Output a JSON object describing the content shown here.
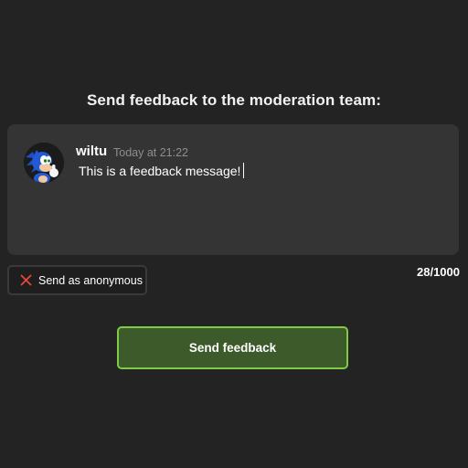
{
  "title": "Send feedback to the moderation team:",
  "message": {
    "username": "wiltu",
    "timestamp": "Today at 21:22",
    "text": "This is a feedback message!",
    "avatar_icon": "hedgehog-avatar-icon"
  },
  "anonymous": {
    "label": "Send as anonymous",
    "icon": "x-icon",
    "checked": false
  },
  "char_count": "28/1000",
  "send_button": {
    "label": "Send feedback"
  },
  "colors": {
    "background": "#232323",
    "message_box": "#343434",
    "x_icon": "#e8473a",
    "button_fill": "#3c5a2a",
    "button_border": "#7fcb45"
  }
}
